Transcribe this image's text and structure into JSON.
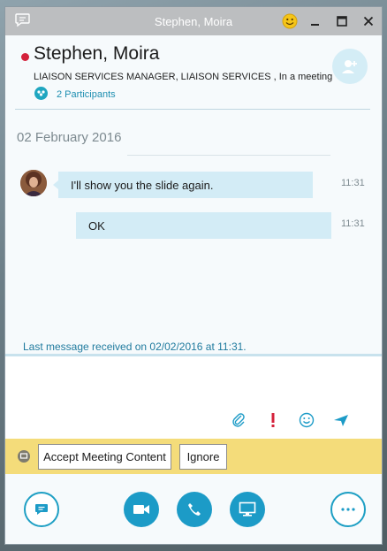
{
  "window": {
    "title": "Stephen, Moira"
  },
  "contact": {
    "name": "Stephen, Moira",
    "subtitle": "LIAISON  SERVICES MANAGER, LIAISON SERVICES , In a meeting",
    "participants_label": "2 Participants",
    "presence_color": "#d4213b"
  },
  "conversation": {
    "date": "02 February 2016",
    "messages": [
      {
        "text": "I'll show you the slide again.",
        "time": "11:31"
      },
      {
        "text": "OK",
        "time": "11:31"
      }
    ],
    "last_received": "Last message received on 02/02/2016 at 11:31."
  },
  "compose_tools": [
    "attach-icon",
    "importance-icon",
    "emoticon-icon",
    "send-icon"
  ],
  "notification": {
    "accept_label": "Accept Meeting Content",
    "ignore_label": "Ignore"
  },
  "actions": [
    "im-icon",
    "video-icon",
    "call-icon",
    "present-icon",
    "more-icon"
  ],
  "colors": {
    "accent": "#1c9bc7",
    "notify_bg": "#f4dc7a",
    "bubble_bg": "#d3ecf6"
  }
}
